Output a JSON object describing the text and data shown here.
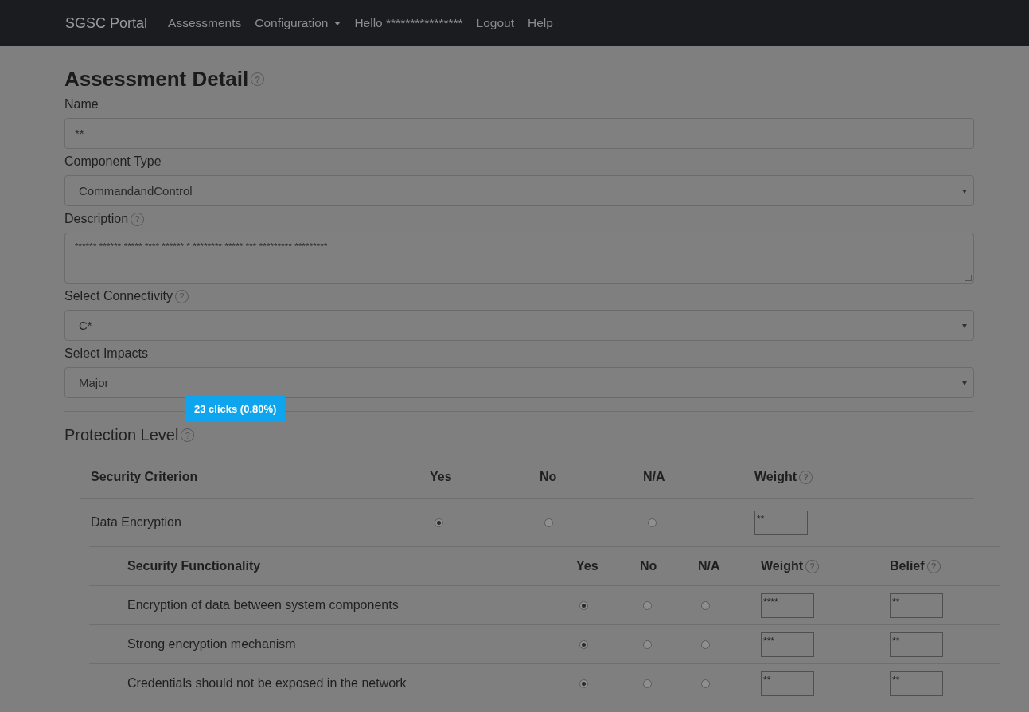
{
  "navbar": {
    "brand": "SGSC Portal",
    "links": [
      {
        "label": "Assessments",
        "dropdown": false
      },
      {
        "label": "Configuration",
        "dropdown": true
      },
      {
        "label": "Hello ****************",
        "dropdown": false
      },
      {
        "label": "Logout",
        "dropdown": false
      },
      {
        "label": "Help",
        "dropdown": false
      }
    ]
  },
  "title": "Assessment Detail",
  "title_help": "?",
  "fields": [
    {
      "kind": "text",
      "label": "Name",
      "value": "**"
    },
    {
      "kind": "select",
      "label": "Component Type",
      "value": "CommandandControl"
    },
    {
      "kind": "textarea",
      "label": "Description",
      "value": "****** ****** ***** **** ****** * ******** ***** *** ********* *********",
      "help": "?"
    },
    {
      "kind": "select",
      "label": "Select Connectivity",
      "value": "C*",
      "help": "?"
    },
    {
      "kind": "select",
      "label": "Select Impacts",
      "value": "Major"
    }
  ],
  "section": {
    "title": "Protection Level",
    "help": "?",
    "tooltip": "23 clicks (0.80%)"
  },
  "criteria_table": {
    "columns": [
      {
        "label": "Security Criterion"
      },
      {
        "label": "Yes"
      },
      {
        "label": "No"
      },
      {
        "label": "N/A"
      },
      {
        "label": "Weight",
        "help": "?"
      }
    ],
    "rows": [
      {
        "name": "Data Encryption",
        "options": [
          {
            "selected": true
          },
          {
            "selected": false
          },
          {
            "selected": false
          }
        ],
        "weight": "**"
      }
    ]
  },
  "functionality_table": {
    "columns": [
      {
        "label": "Security Functionality"
      },
      {
        "label": "Yes"
      },
      {
        "label": "No"
      },
      {
        "label": "N/A"
      },
      {
        "label": "Weight",
        "help": "?"
      },
      {
        "label": "Belief",
        "help": "?"
      }
    ],
    "rows": [
      {
        "name": "Encryption of data between system components",
        "options": [
          {
            "selected": true
          },
          {
            "selected": false
          },
          {
            "selected": false
          }
        ],
        "weight": "****",
        "belief": "**"
      },
      {
        "name": "Strong encryption mechanism",
        "options": [
          {
            "selected": true
          },
          {
            "selected": false
          },
          {
            "selected": false
          }
        ],
        "weight": "***",
        "belief": "**"
      },
      {
        "name": "Credentials should not be exposed in the network",
        "options": [
          {
            "selected": true
          },
          {
            "selected": false
          },
          {
            "selected": false
          }
        ],
        "weight": "**",
        "belief": "**"
      }
    ]
  }
}
